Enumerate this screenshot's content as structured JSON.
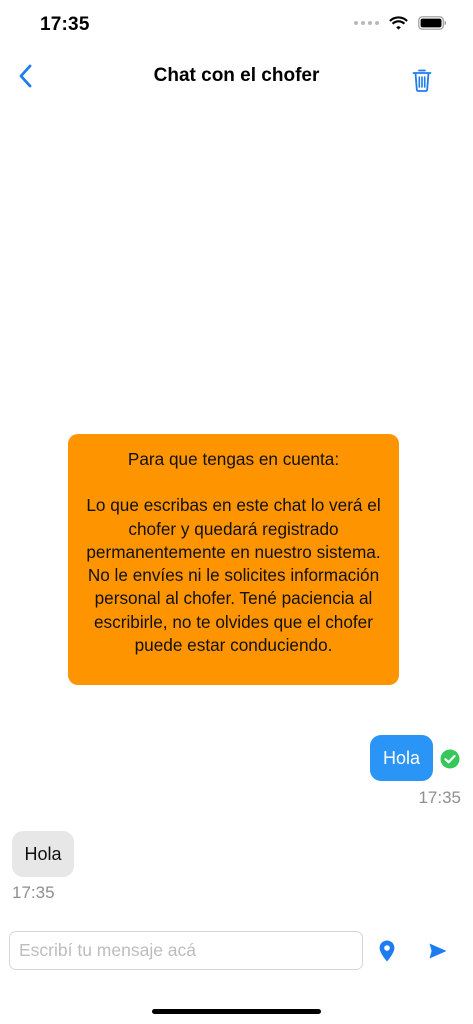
{
  "status_bar": {
    "time": "17:35",
    "icons": [
      "signal-dots-icon",
      "wifi-icon",
      "battery-icon"
    ]
  },
  "nav": {
    "title": "Chat con el chofer",
    "back_icon": "chevron-left-icon",
    "trash_icon": "trash-icon"
  },
  "notice": {
    "title": "Para que tengas en cuenta:",
    "body": "Lo que escribas en este chat lo verá el chofer y quedará registrado permanentemente en nuestro sistema. No le envíes ni le solicites información personal al chofer. Tené paciencia al escribirle, no te olvides que el chofer puede estar conduciendo."
  },
  "messages": [
    {
      "direction": "outgoing",
      "text": "Hola",
      "time": "17:35",
      "status_icon": "read-check-icon"
    },
    {
      "direction": "incoming",
      "text": "Hola",
      "time": "17:35"
    }
  ],
  "composer": {
    "placeholder": "Escribí tu mensaje acá",
    "value": "",
    "location_icon": "location-pin-icon",
    "send_icon": "send-icon"
  },
  "colors": {
    "accent": "#1e7cf0",
    "notice_bg": "#fe9400",
    "outgoing_bubble": "#2b95f7",
    "incoming_bubble": "#e7e7e7",
    "read_check": "#34c759",
    "timestamp": "#8e8e93"
  }
}
